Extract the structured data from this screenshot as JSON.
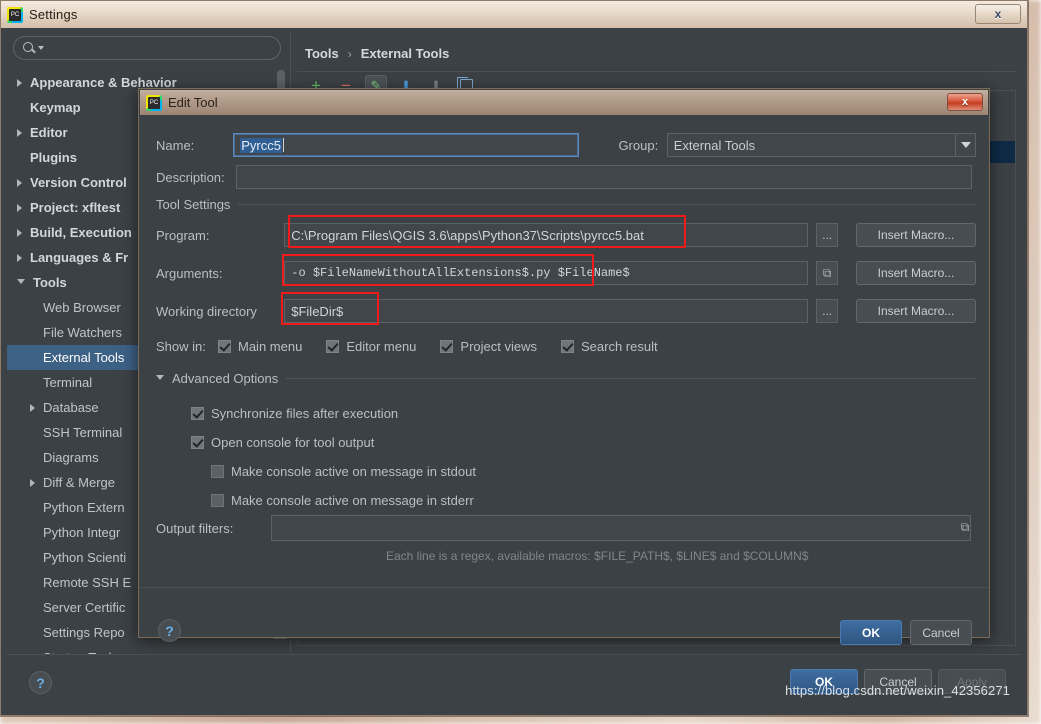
{
  "window": {
    "title": "Settings",
    "close_label": "x",
    "app_icon": "pycharm-icon"
  },
  "sidebar": {
    "search_placeholder": "",
    "items": [
      {
        "label": "Appearance & Behavior",
        "arrow": "right",
        "level": 0,
        "bold": true
      },
      {
        "label": "Keymap",
        "arrow": "none",
        "level": 0,
        "bold": true
      },
      {
        "label": "Editor",
        "arrow": "right",
        "level": 0,
        "bold": true
      },
      {
        "label": "Plugins",
        "arrow": "none",
        "level": 0,
        "bold": true
      },
      {
        "label": "Version Control",
        "arrow": "right",
        "level": 0,
        "bold": true
      },
      {
        "label": "Project: xfltest",
        "arrow": "right",
        "level": 0,
        "bold": true
      },
      {
        "label": "Build, Execution",
        "arrow": "right",
        "level": 0,
        "bold": true
      },
      {
        "label": "Languages & Fr",
        "arrow": "right",
        "level": 0,
        "bold": true
      },
      {
        "label": "Tools",
        "arrow": "down",
        "level": 0,
        "bold": true
      },
      {
        "label": "Web Browser",
        "arrow": "none",
        "level": 1,
        "bold": false
      },
      {
        "label": "File Watchers",
        "arrow": "none",
        "level": 1,
        "bold": false
      },
      {
        "label": "External Tools",
        "arrow": "none",
        "level": 1,
        "bold": false,
        "selected": true
      },
      {
        "label": "Terminal",
        "arrow": "none",
        "level": 1,
        "bold": false
      },
      {
        "label": "Database",
        "arrow": "right",
        "level": 1,
        "bold": false
      },
      {
        "label": "SSH Terminal",
        "arrow": "none",
        "level": 1,
        "bold": false
      },
      {
        "label": "Diagrams",
        "arrow": "none",
        "level": 1,
        "bold": false
      },
      {
        "label": "Diff & Merge",
        "arrow": "right",
        "level": 1,
        "bold": false
      },
      {
        "label": "Python Extern",
        "arrow": "none",
        "level": 1,
        "bold": false
      },
      {
        "label": "Python Integr",
        "arrow": "none",
        "level": 1,
        "bold": false
      },
      {
        "label": "Python Scienti",
        "arrow": "none",
        "level": 1,
        "bold": false
      },
      {
        "label": "Remote SSH E",
        "arrow": "none",
        "level": 1,
        "bold": false
      },
      {
        "label": "Server Certific",
        "arrow": "none",
        "level": 1,
        "bold": false
      },
      {
        "label": "Settings Repo",
        "arrow": "none",
        "level": 1,
        "bold": false
      },
      {
        "label": "Startup Tasks",
        "arrow": "none",
        "level": 1,
        "bold": false
      }
    ]
  },
  "right_pane": {
    "breadcrumb": {
      "parent": "Tools",
      "separator": "›",
      "current": "External Tools"
    },
    "toolbar": [
      {
        "name": "add-button",
        "glyph": "+"
      },
      {
        "name": "remove-button",
        "glyph": "−"
      },
      {
        "name": "edit-button",
        "glyph": "✎"
      },
      {
        "name": "move-up-button",
        "glyph": "↑"
      },
      {
        "name": "move-down-button",
        "glyph": "↓"
      },
      {
        "name": "copy-button",
        "glyph": ""
      }
    ]
  },
  "settings_footer": {
    "help": "?",
    "ok": "OK",
    "cancel": "Cancel",
    "apply": "Apply"
  },
  "watermark": "https://blog.csdn.net/weixin_42356271",
  "dialog": {
    "title": "Edit Tool",
    "close_label": "x",
    "name_label": "Name:",
    "name_value": "Pyrcc5",
    "group_label": "Group:",
    "group_value": "External Tools",
    "description_label": "Description:",
    "description_value": "",
    "tool_settings_label": "Tool Settings",
    "program_label": "Program:",
    "program_value": "C:\\Program Files\\QGIS 3.6\\apps\\Python37\\Scripts\\pyrcc5.bat",
    "arguments_label": "Arguments:",
    "arguments_value": "-o $FileNameWithoutAllExtensions$.py $FileName$",
    "working_directory_label": "Working directory",
    "working_directory_value": "$FileDir$",
    "browse_label": "...",
    "expand_label": "⤡",
    "insert_macro_label": "Insert Macro...",
    "show_in_label": "Show in:",
    "show_in_options": [
      {
        "label": "Main menu",
        "checked": true
      },
      {
        "label": "Editor menu",
        "checked": true
      },
      {
        "label": "Project views",
        "checked": true
      },
      {
        "label": "Search result",
        "checked": true
      }
    ],
    "advanced_options_label": "Advanced Options",
    "advanced_options": [
      {
        "label": "Synchronize files after execution",
        "checked": true,
        "indent": 0
      },
      {
        "label": "Open console for tool output",
        "checked": true,
        "indent": 0
      },
      {
        "label": "Make console active on message in stdout",
        "checked": false,
        "indent": 1
      },
      {
        "label": "Make console active on message in stderr",
        "checked": false,
        "indent": 1
      }
    ],
    "output_filters_label": "Output filters:",
    "output_filters_value": "",
    "output_filters_hint": "Each line is a regex, available macros: $FILE_PATH$, $LINE$ and $COLUMN$",
    "help": "?",
    "ok": "OK",
    "cancel": "Cancel"
  },
  "colors": {
    "highlight_red": "#ef1a1a",
    "selection_blue": "#3d6185",
    "primary_button": "#3f6ea2",
    "panel_bg": "#3c4145"
  }
}
